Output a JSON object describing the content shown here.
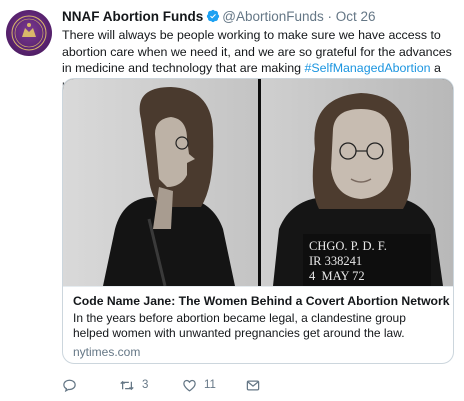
{
  "tweet": {
    "author_name": "NNAF Abortion Funds",
    "author_handle": "@AbortionFunds",
    "separator": "·",
    "date": "Oct 26",
    "text_before": "There will always be people working to make sure we have access to abortion care when we need it, and we are so grateful for the advances in medicine and technology that are making ",
    "hashtag": "#SelfManagedAbortion",
    "text_after": " a reality for more people.",
    "avatar_icon": "nnaf-logo-icon"
  },
  "card": {
    "title": "Code Name Jane: The Women Behind a Covert Abortion Network",
    "description": "In the years before abortion became legal, a clandestine group helped women with unwanted pregnancies get around the law.",
    "domain": "nytimes.com",
    "image": {
      "placard_line1": "CHGO. P. D. F.",
      "placard_line2": "IR 338241",
      "placard_line3": "4  MAY 72"
    }
  },
  "actions": {
    "reply_icon": "reply-icon",
    "retweet_icon": "retweet-icon",
    "retweet_count": "3",
    "like_icon": "heart-icon",
    "like_count": "11",
    "dm_icon": "envelope-icon"
  },
  "colors": {
    "link": "#1b95e0",
    "muted": "#657786",
    "text": "#14171a",
    "verified": "#1da1f2",
    "border": "#ccd6dd"
  }
}
